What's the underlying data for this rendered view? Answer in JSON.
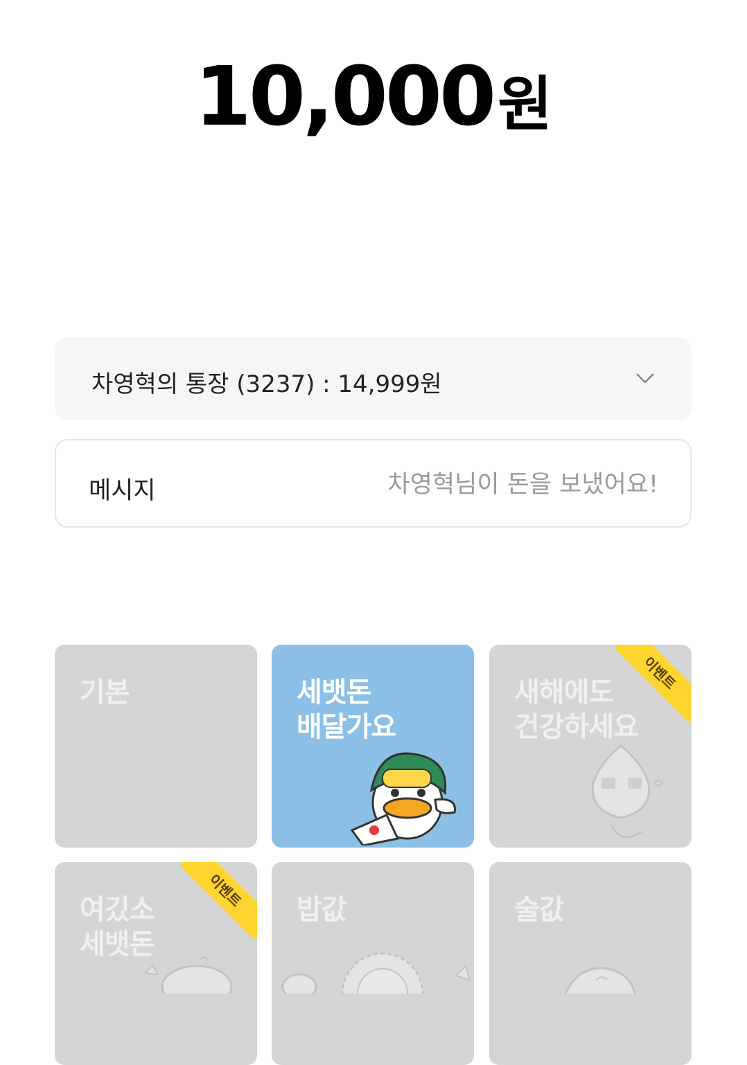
{
  "amount": {
    "value": "10,000",
    "unit": "원"
  },
  "account": {
    "label": "차영혁의 통장 (3237) : 14,999원"
  },
  "message": {
    "label": "메시지",
    "placeholder": "차영혁님이 돈을 보냈어요!"
  },
  "cards": [
    {
      "title": "기본",
      "selected": false
    },
    {
      "title": "세뱃돈\n배달가요",
      "selected": true
    },
    {
      "title": "새해에도\n건강하세요",
      "badge": "이벤트",
      "selected": false
    },
    {
      "title": "여깄소\n세뱃돈",
      "badge": "이벤트",
      "selected": false
    },
    {
      "title": "밥값",
      "selected": false
    },
    {
      "title": "술값",
      "selected": false
    }
  ],
  "colors": {
    "selected_card": "#8cbfe6",
    "card": "#d5d5d5",
    "badge": "#ffd530"
  }
}
